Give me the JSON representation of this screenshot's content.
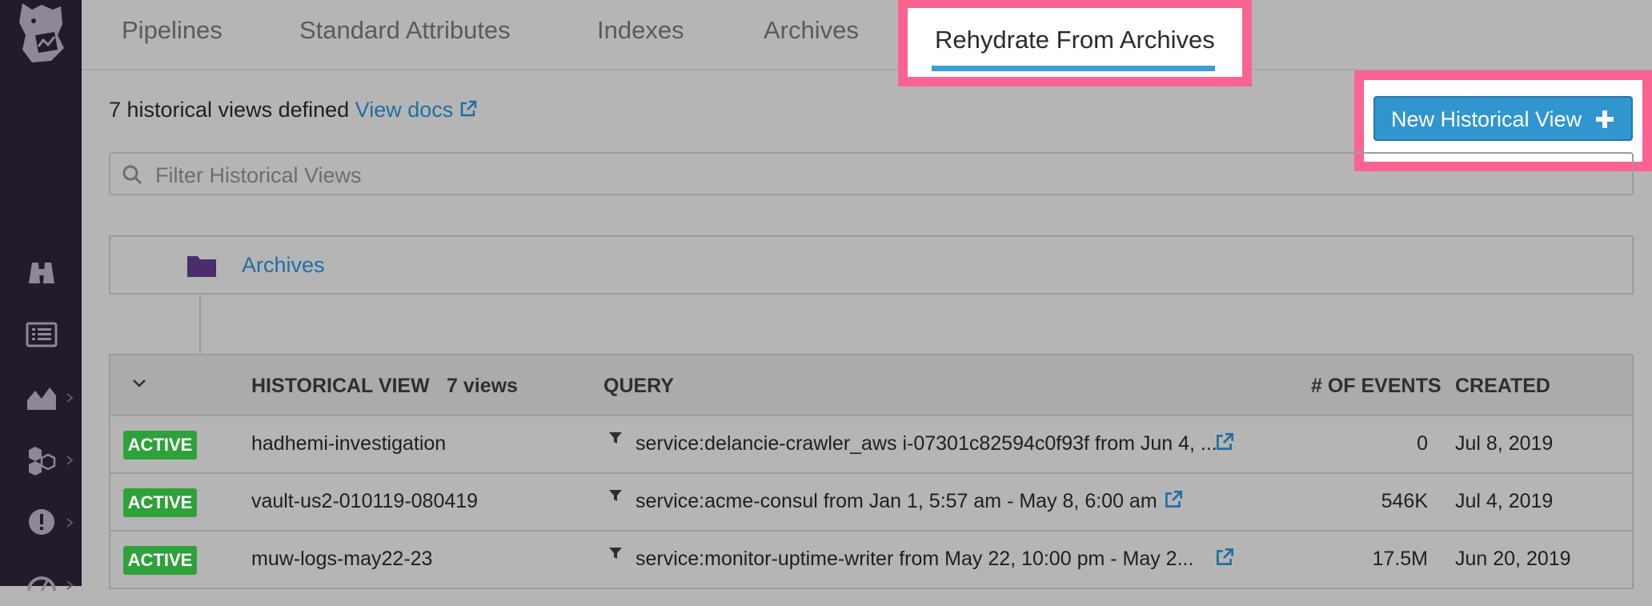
{
  "tabs": [
    {
      "label": "Pipelines"
    },
    {
      "label": "Standard Attributes"
    },
    {
      "label": "Indexes"
    },
    {
      "label": "Archives"
    },
    {
      "label": "Rehydrate From Archives"
    }
  ],
  "summary": {
    "text": "7 historical views defined",
    "docs_link": "View docs"
  },
  "new_button": {
    "label": "New Historical View"
  },
  "filter": {
    "placeholder": "Filter Historical Views"
  },
  "folder": {
    "label": "Archives"
  },
  "table": {
    "headers": {
      "historical_view": "HISTORICAL VIEW",
      "view_count": "7 views",
      "query": "QUERY",
      "events": "# OF EVENTS",
      "created": "CREATED"
    },
    "rows": [
      {
        "status": "ACTIVE",
        "name": "hadhemi-investigation",
        "query": "service:delancie-crawler_aws i-07301c82594c0f93f from Jun 4, ...",
        "events": "0",
        "created": "Jul 8, 2019"
      },
      {
        "status": "ACTIVE",
        "name": "vault-us2-010119-080419",
        "query": "service:acme-consul  from Jan 1, 5:57 am - May 8, 6:00 am",
        "events": "546K",
        "created": "Jul 4, 2019"
      },
      {
        "status": "ACTIVE",
        "name": "muw-logs-may22-23",
        "query": "service:monitor-uptime-writer from May 22, 10:00 pm - May 2...",
        "events": "17.5M",
        "created": "Jun 20, 2019"
      }
    ]
  },
  "colors": {
    "accent": "#3195cf",
    "highlight": "#fb6392",
    "active_badge": "#2fa13a",
    "link": "#1f6fa3",
    "sidebar": "#231a2c"
  }
}
